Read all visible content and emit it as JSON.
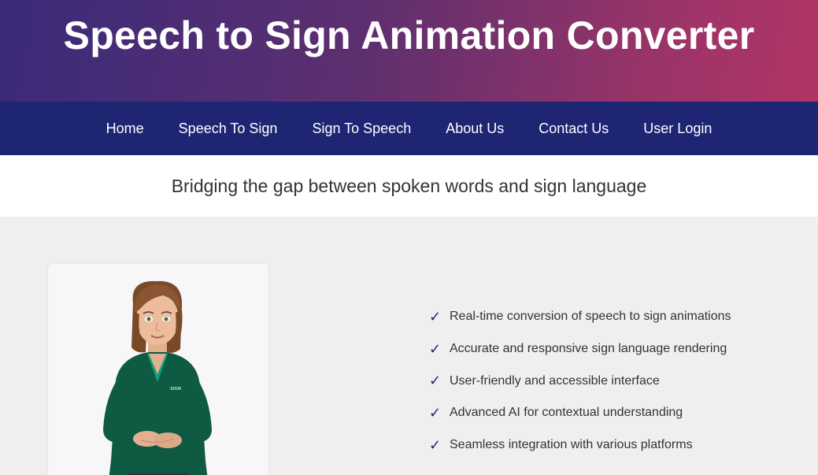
{
  "header": {
    "title": "Speech to Sign Animation Converter"
  },
  "nav": {
    "items": [
      {
        "label": "Home"
      },
      {
        "label": "Speech To Sign"
      },
      {
        "label": "Sign To Speech"
      },
      {
        "label": "About Us"
      },
      {
        "label": "Contact Us"
      },
      {
        "label": "User Login"
      }
    ]
  },
  "tagline": "Bridging the gap between spoken words and sign language",
  "avatar": {
    "badge_text": "SIGN"
  },
  "features": {
    "check_glyph": "✓",
    "items": [
      "Real-time conversion of speech to sign animations",
      "Accurate and responsive sign language rendering",
      "User-friendly and accessible interface",
      "Advanced AI for contextual understanding",
      "Seamless integration with various platforms"
    ]
  },
  "colors": {
    "header_gradient_start": "#3a2a7a",
    "header_gradient_end": "#b23466",
    "nav_background": "#1e2573",
    "page_background": "#efefef",
    "check_color": "#1e2573"
  }
}
